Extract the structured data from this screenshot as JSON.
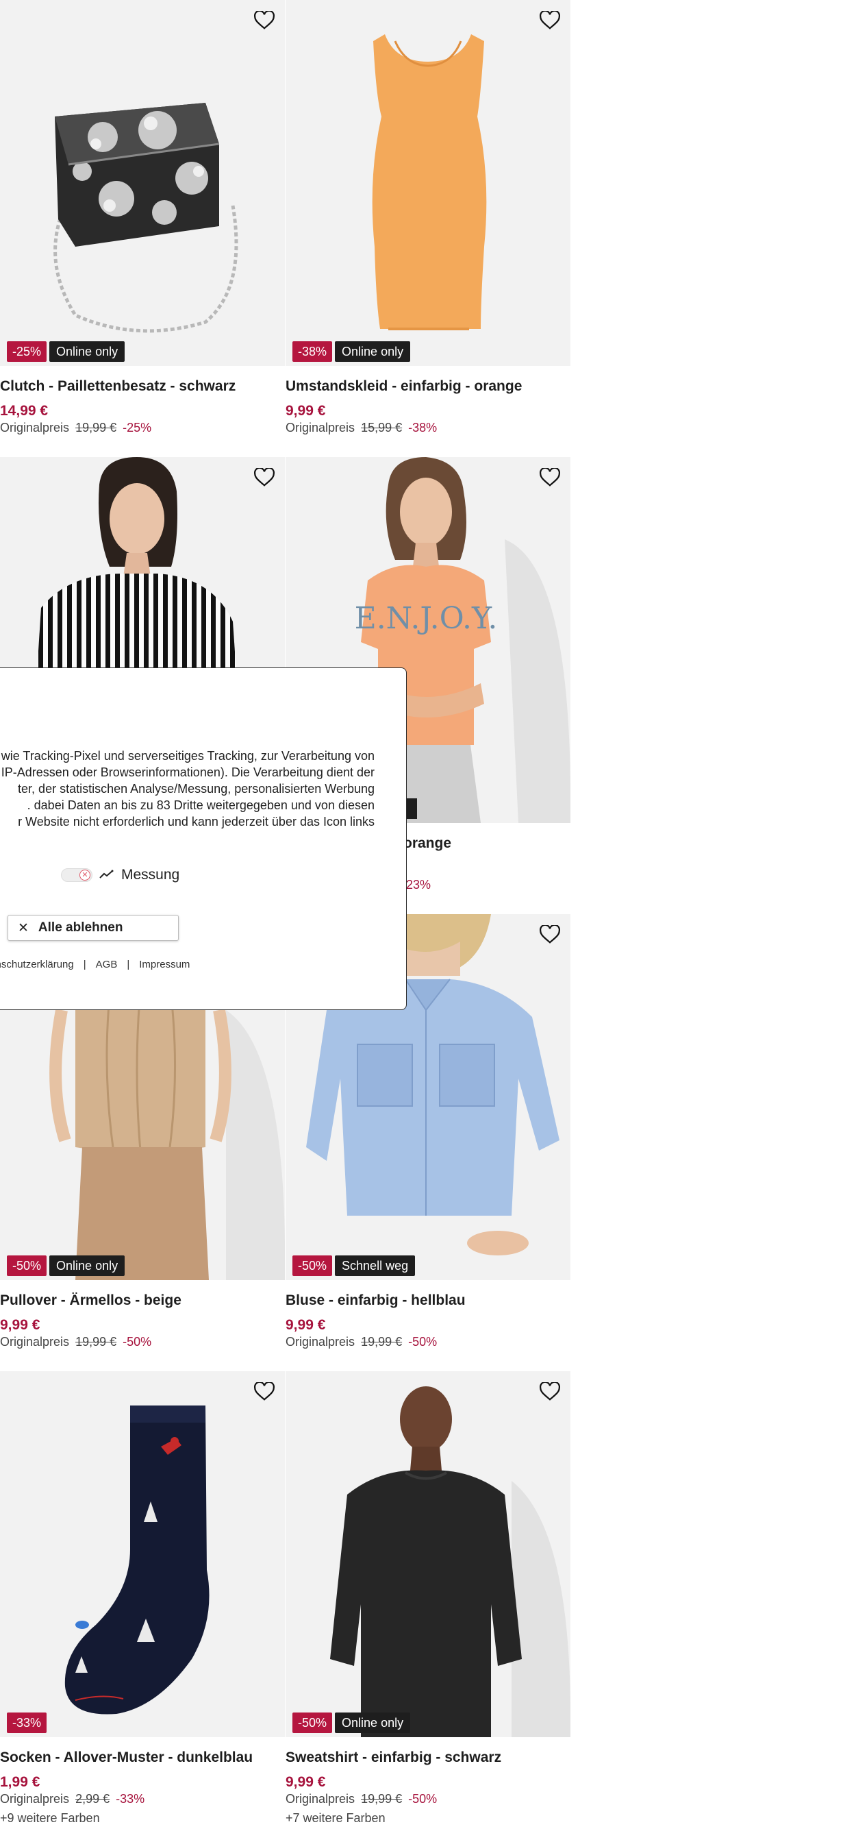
{
  "products": [
    {
      "title": "Clutch - Paillettenbesatz - schwarz",
      "price": "14,99 €",
      "orig_label": "Originalpreis",
      "orig_price": "19,99 €",
      "orig_pct": "-25%",
      "badge_disc": "-25%",
      "badge_tag": "Online only",
      "more_colors": ""
    },
    {
      "title": "Umstandskleid - einfarbig - orange",
      "price": "9,99 €",
      "orig_label": "Originalpreis",
      "orig_price": "15,99 €",
      "orig_pct": "-38%",
      "badge_disc": "-38%",
      "badge_tag": "Online only",
      "more_colors": ""
    },
    {
      "title": "",
      "price": "",
      "orig_label": "",
      "orig_price": "",
      "orig_pct": "",
      "badge_disc": "",
      "badge_tag": "",
      "more_colors": ""
    },
    {
      "title": "orange",
      "price": "",
      "orig_label": "",
      "orig_price": "",
      "orig_pct": "23%",
      "badge_disc": "",
      "badge_tag": "",
      "more_colors": ""
    },
    {
      "title": "Pullover - Ärmellos - beige",
      "price": "9,99 €",
      "orig_label": "Originalpreis",
      "orig_price": "19,99 €",
      "orig_pct": "-50%",
      "badge_disc": "-50%",
      "badge_tag": "Online only",
      "more_colors": ""
    },
    {
      "title": "Bluse - einfarbig - hellblau",
      "price": "9,99 €",
      "orig_label": "Originalpreis",
      "orig_price": "19,99 €",
      "orig_pct": "-50%",
      "badge_disc": "-50%",
      "badge_tag": "Schnell weg",
      "more_colors": ""
    },
    {
      "title": "Socken - Allover-Muster - dunkelblau",
      "price": "1,99 €",
      "orig_label": "Originalpreis",
      "orig_price": "2,99 €",
      "orig_pct": "-33%",
      "badge_disc": "-33%",
      "badge_tag": "",
      "more_colors": "+9 weitere Farben"
    },
    {
      "title": "Sweatshirt - einfarbig - schwarz",
      "price": "9,99 €",
      "orig_label": "Originalpreis",
      "orig_price": "19,99 €",
      "orig_pct": "-50%",
      "badge_disc": "-50%",
      "badge_tag": "Online only",
      "more_colors": "+7 weitere Farben"
    }
  ],
  "consent": {
    "lines": [
      "wie Tracking-Pixel und serverseitiges Tracking, zur Verarbeitung von",
      "IP-Adressen oder Browserinformationen). Die Verarbeitung dient der",
      "ter, der statistischen Analyse/Messung, personalisierten Werbung",
      ". dabei Daten an bis zu 83 Dritte weitergegeben und von diesen",
      "r Website nicht erforderlich und kann jederzeit über das Icon links"
    ],
    "toggle_label": "Messung",
    "reject_label": "Alle ablehnen",
    "link_privacy": "tenschutzerklärung",
    "link_terms": "AGB",
    "link_imprint": "Impressum",
    "link_sep": "|"
  },
  "colors": {
    "sale": "#a6123c",
    "badge": "#b5163f",
    "dark": "#1e1e1e"
  }
}
